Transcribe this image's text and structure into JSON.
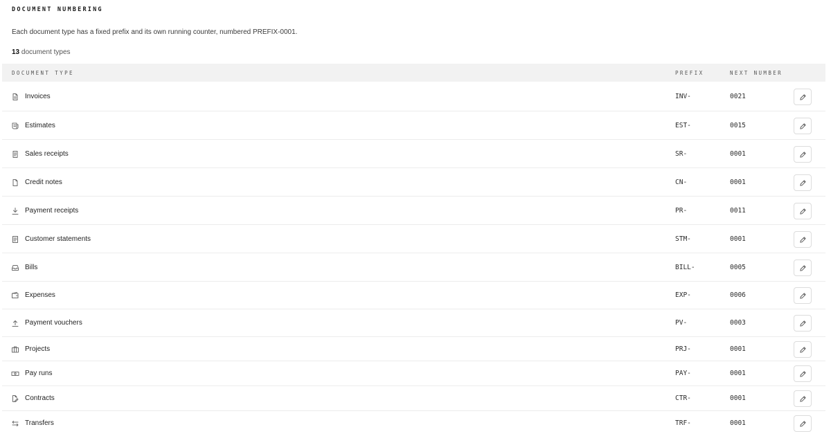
{
  "section": {
    "title": "DOCUMENT NUMBERING",
    "description": "Each document type has a fixed prefix and its own running counter, numbered PREFIX-0001.",
    "count_number": "13",
    "count_label": " document types"
  },
  "table": {
    "headers": {
      "type": "DOCUMENT TYPE",
      "prefix": "PREFIX",
      "next": "NEXT NUMBER"
    },
    "rows": [
      {
        "icon": "invoice-icon",
        "name": "Invoices",
        "prefix": "INV-",
        "next": "0021"
      },
      {
        "icon": "estimate-icon",
        "name": "Estimates",
        "prefix": "EST-",
        "next": "0015"
      },
      {
        "icon": "receipt-icon",
        "name": "Sales receipts",
        "prefix": "SR-",
        "next": "0001"
      },
      {
        "icon": "file-icon",
        "name": "Credit notes",
        "prefix": "CN-",
        "next": "0001"
      },
      {
        "icon": "download-icon",
        "name": "Payment receipts",
        "prefix": "PR-",
        "next": "0011"
      },
      {
        "icon": "statement-icon",
        "name": "Customer statements",
        "prefix": "STM-",
        "next": "0001"
      },
      {
        "icon": "inbox-icon",
        "name": "Bills",
        "prefix": "BILL-",
        "next": "0005"
      },
      {
        "icon": "wallet-icon",
        "name": "Expenses",
        "prefix": "EXP-",
        "next": "0006"
      },
      {
        "icon": "upload-icon",
        "name": "Payment vouchers",
        "prefix": "PV-",
        "next": "0003"
      },
      {
        "icon": "briefcase-icon",
        "name": "Projects",
        "prefix": "PRJ-",
        "next": "0001"
      },
      {
        "icon": "banknote-icon",
        "name": "Pay runs",
        "prefix": "PAY-",
        "next": "0001"
      },
      {
        "icon": "contract-icon",
        "name": "Contracts",
        "prefix": "CTR-",
        "next": "0001"
      },
      {
        "icon": "transfer-icon",
        "name": "Transfers",
        "prefix": "TRF-",
        "next": "0001"
      }
    ]
  },
  "actions": {
    "edit_icon": "pencil-icon"
  }
}
